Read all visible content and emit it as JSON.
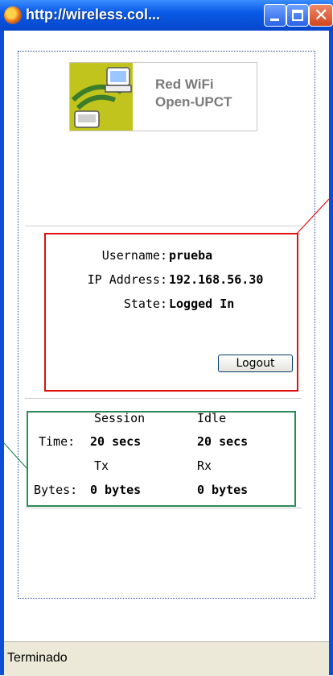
{
  "window": {
    "title": "http://wireless.col..."
  },
  "logo": {
    "line1": "Red WiFi",
    "line2": "Open-UPCT",
    "accent_color": "#c2c41e"
  },
  "user_info": {
    "username_label": "Username:",
    "username_value": "prueba",
    "ip_label": "IP Address:",
    "ip_value": "192.168.56.30",
    "state_label": "State:",
    "state_value": "Logged In",
    "logout_label": "Logout"
  },
  "stats": {
    "col1_header": "Session",
    "col2_header": "Idle",
    "time_label": "Time:",
    "time_session": "20 secs",
    "time_idle": "20 secs",
    "col3_header": "Tx",
    "col4_header": "Rx",
    "bytes_label": "Bytes:",
    "bytes_tx": "0 bytes",
    "bytes_rx": "0 bytes"
  },
  "status_bar": {
    "text": "Terminado"
  },
  "colors": {
    "title_bar": "#0a5ae8",
    "info_box_border": "#e01010",
    "stats_box_border": "#2e8b57"
  }
}
